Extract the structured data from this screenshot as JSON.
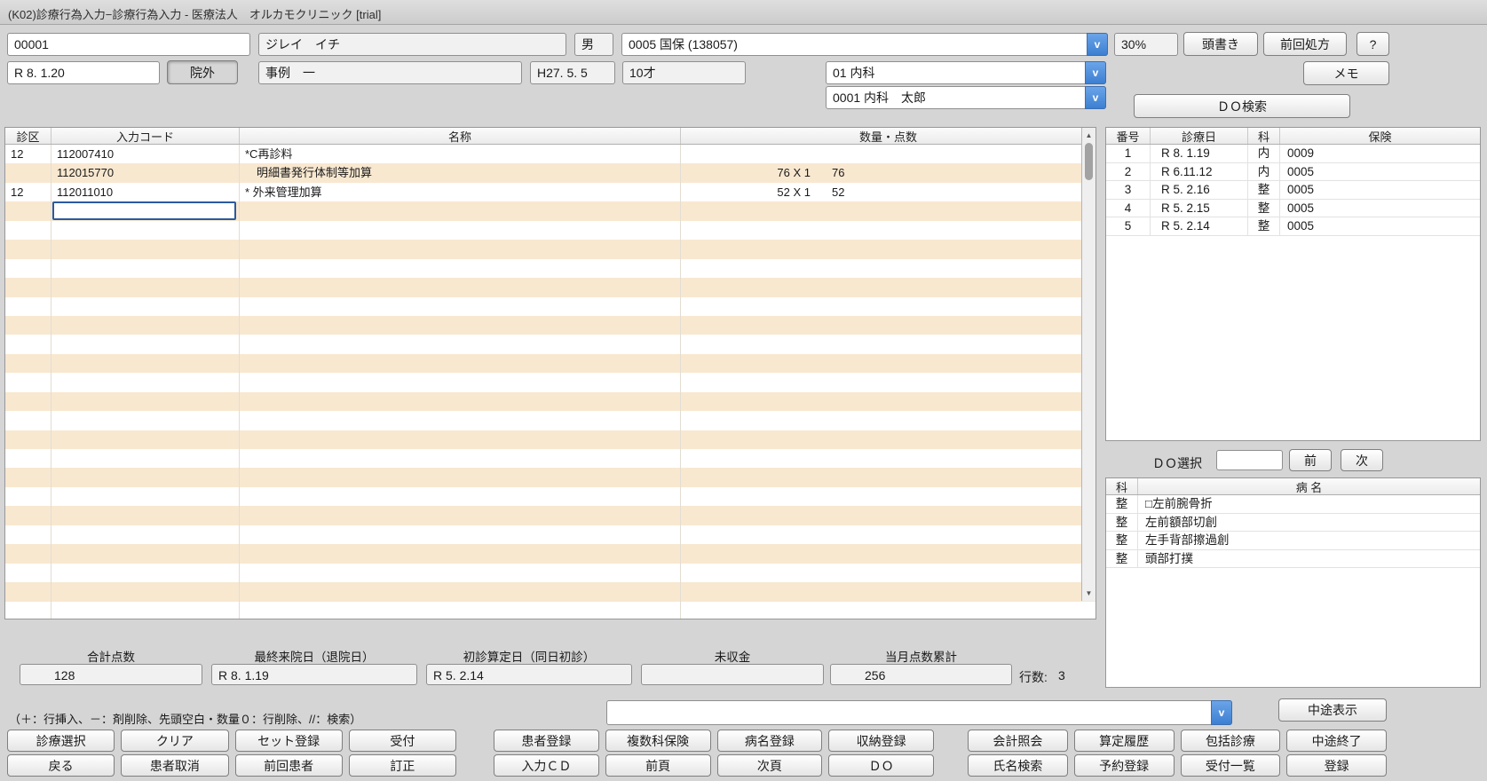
{
  "window": {
    "title": "(K02)診療行為入力−診療行為入力 - 医療法人　オルカモクリニック [trial]"
  },
  "colors": {
    "accent_blue": "#4788d8",
    "row_stripe": "#f8e8d0",
    "focus_border": "#2a5aa0"
  },
  "icons": {
    "chevron_down": "v",
    "scroll_up": "▲",
    "scroll_down": "▼"
  },
  "patient": {
    "id": "00001",
    "kana_name": "ジレイ　イチ",
    "sex": "男",
    "insurance": "0005 国保 (138057)",
    "burden_rate": "30%",
    "visit_date": "R 8. 1.20",
    "in_out": "院外",
    "name": "事例　一",
    "birth_date": "H27. 5. 5",
    "age": "10才",
    "department": "01 内科",
    "doctor": "0001 内科　太郎"
  },
  "top_buttons": {
    "header_note": "頭書き",
    "previous_rx": "前回処方",
    "help": "?",
    "memo": "メモ",
    "do_search": "ＤＯ検索"
  },
  "entry_grid": {
    "headers": {
      "category": "診区",
      "code": "入力コード",
      "name": "名称",
      "quantity": "数量・点数"
    },
    "rows": [
      {
        "category": "12",
        "code": "112007410",
        "name": "*C再診料",
        "qty": "",
        "points": ""
      },
      {
        "category": "",
        "code": "112015770",
        "name": "　明細書発行体制等加算",
        "qty": "76 X 1",
        "points": "76"
      },
      {
        "category": "12",
        "code": "112011010",
        "name": "* 外来管理加算",
        "qty": "52 X 1",
        "points": "52"
      }
    ]
  },
  "visit_history": {
    "headers": [
      "番号",
      "診療日",
      "科",
      "保険"
    ],
    "rows": [
      [
        "1",
        "R 8. 1.19",
        "内",
        "0009"
      ],
      [
        "2",
        "R 6.11.12",
        "内",
        "0005"
      ],
      [
        "3",
        "R 5. 2.16",
        "整",
        "0005"
      ],
      [
        "4",
        "R 5. 2.15",
        "整",
        "0005"
      ],
      [
        "5",
        "R 5. 2.14",
        "整",
        "0005"
      ]
    ]
  },
  "do_select": {
    "label": "ＤＯ選択",
    "value": "",
    "prev": "前",
    "next": "次"
  },
  "diseases": {
    "headers": [
      "科",
      "病 名"
    ],
    "rows": [
      [
        "整",
        "□左前腕骨折"
      ],
      [
        "整",
        "左前額部切創"
      ],
      [
        "整",
        "左手背部擦過創"
      ],
      [
        "整",
        "頭部打撲"
      ]
    ]
  },
  "summary": {
    "total_points_label": "合計点数",
    "total_points": "128",
    "last_visit_label": "最終来院日（退院日）",
    "last_visit": "R 8. 1.19",
    "first_visit_label": "初診算定日（同日初診）",
    "first_visit": "R 5. 2.14",
    "unpaid_label": "未収金",
    "unpaid": "",
    "month_points_label": "当月点数累計",
    "month_points": "256",
    "line_count_label": "行数:",
    "line_count": "3"
  },
  "hint": "（＋：行挿入、－：剤削除、先頭空白・数量０：行削除、//：検索）",
  "quick_entry": {
    "value": ""
  },
  "chuto_display": "中途表示",
  "bottom_buttons": {
    "g1r1": [
      "診療選択",
      "クリア",
      "セット登録",
      "受付"
    ],
    "g1r2": [
      "戻る",
      "患者取消",
      "前回患者",
      "訂正"
    ],
    "g2r1": [
      "患者登録",
      "複数科保険",
      "病名登録",
      "収納登録"
    ],
    "g2r2": [
      "入力ＣＤ",
      "前頁",
      "次頁",
      "ＤＯ"
    ],
    "g3r1": [
      "会計照会",
      "算定履歴",
      "包括診療",
      "中途終了"
    ],
    "g3r2": [
      "氏名検索",
      "予約登録",
      "受付一覧",
      "登録"
    ]
  }
}
